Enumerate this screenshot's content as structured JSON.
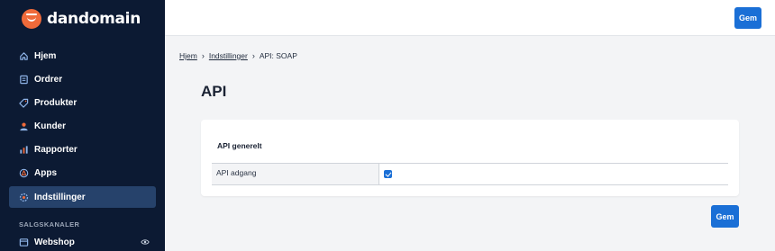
{
  "brand": {
    "name": "dandomain",
    "accent": "#ef6a3a"
  },
  "sidebar": {
    "items": [
      {
        "label": "Hjem",
        "icon": "home-icon",
        "active": false
      },
      {
        "label": "Ordrer",
        "icon": "orders-icon",
        "active": false
      },
      {
        "label": "Produkter",
        "icon": "tag-icon",
        "active": false
      },
      {
        "label": "Kunder",
        "icon": "person-icon",
        "active": false
      },
      {
        "label": "Rapporter",
        "icon": "bar-chart-icon",
        "active": false
      },
      {
        "label": "Apps",
        "icon": "apps-icon",
        "active": false
      },
      {
        "label": "Indstillinger",
        "icon": "settings-icon",
        "active": true
      }
    ],
    "section_label": "SALGSKANALER",
    "channel": {
      "label": "Webshop",
      "icon": "store-icon",
      "visibility_icon": "eye-icon"
    }
  },
  "topbar": {
    "save_label": "Gem"
  },
  "breadcrumb": {
    "home": "Hjem",
    "settings": "Indstillinger",
    "current": "API: SOAP"
  },
  "page": {
    "title": "API"
  },
  "card": {
    "title": "API generelt",
    "row": {
      "label": "API adgang",
      "checked": true
    }
  },
  "footer": {
    "save_label": "Gem"
  },
  "colors": {
    "sidebar_bg": "#0c1a33",
    "active_item": "#26426b",
    "primary": "#1a6fd6"
  }
}
